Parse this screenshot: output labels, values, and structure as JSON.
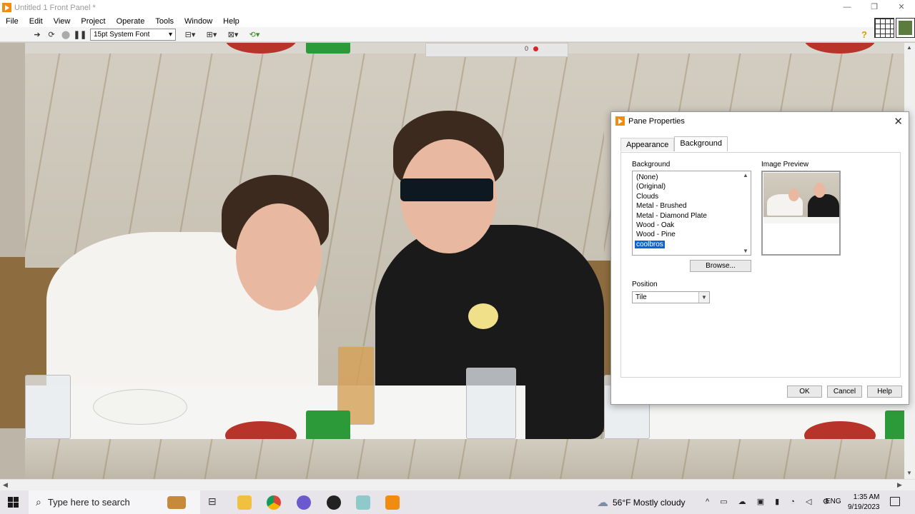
{
  "window": {
    "title": "Untitled 1 Front Panel *",
    "controls": [
      "—",
      "❐",
      "✕"
    ]
  },
  "menu": [
    "File",
    "Edit",
    "View",
    "Project",
    "Operate",
    "Tools",
    "Window",
    "Help"
  ],
  "toolbar": {
    "font_label": "15pt System Font"
  },
  "canvas": {
    "indicator": "0"
  },
  "dialog": {
    "title": "Pane Properties",
    "tabs": [
      "Appearance",
      "Background"
    ],
    "active_tab": "Background",
    "background_label": "Background",
    "background_options": [
      "(None)",
      "(Original)",
      "Clouds",
      "Metal - Brushed",
      "Metal - Diamond Plate",
      "Wood - Oak",
      "Wood - Pine",
      "coolbros"
    ],
    "selected_background": "coolbros",
    "browse_label": "Browse...",
    "preview_label": "Image Preview",
    "position_label": "Position",
    "position_value": "Tile",
    "ok_label": "OK",
    "cancel_label": "Cancel",
    "help_label": "Help"
  },
  "taskbar": {
    "search_placeholder": "Type here to search",
    "weather": "56°F  Mostly cloudy",
    "language": "ENG",
    "time": "1:35 AM",
    "date": "9/19/2023"
  },
  "colors": {
    "labview_orange": "#f28c10",
    "selection_blue": "#0a64d6",
    "dialog_bg": "#ffffff"
  }
}
